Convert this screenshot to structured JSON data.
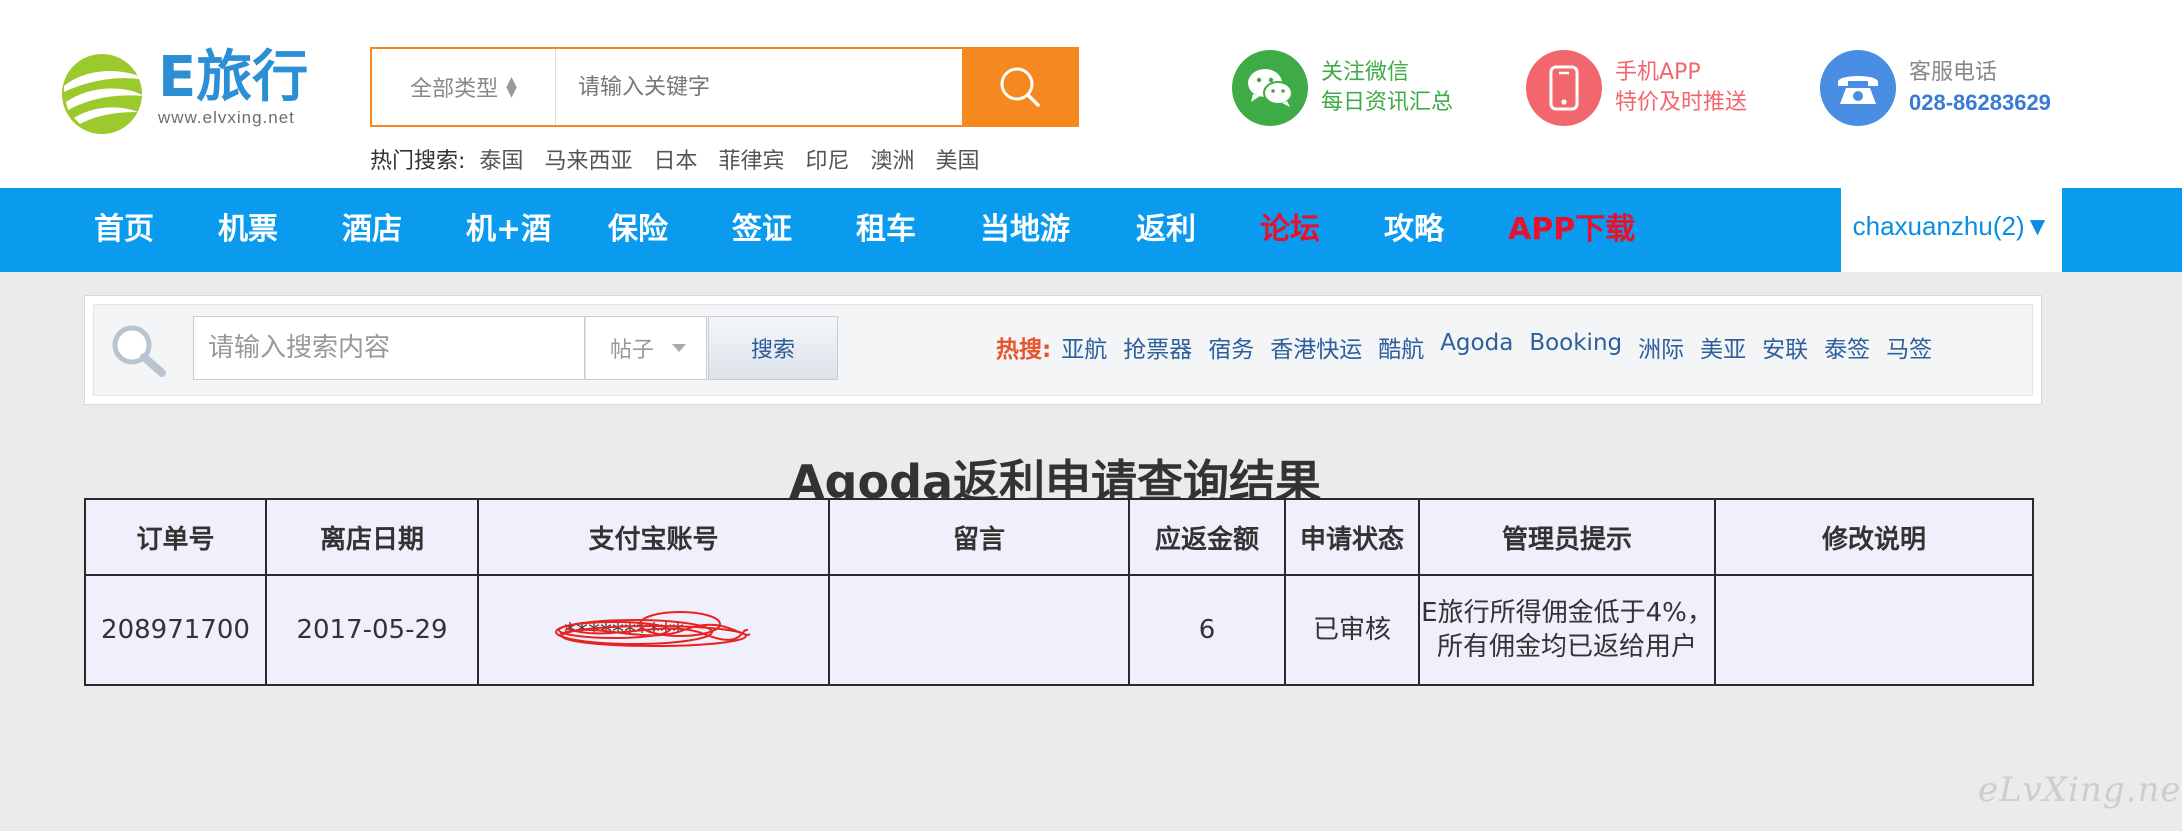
{
  "header": {
    "logo_brand": "E旅行",
    "logo_domain": "www.elvxing.net",
    "search": {
      "type_value": "全部类型",
      "placeholder": "请输入关键字"
    },
    "hot_label": "热门搜索:",
    "hot_items": [
      "泰国",
      "马来西亚",
      "日本",
      "菲律宾",
      "印尼",
      "澳洲",
      "美国"
    ],
    "promos": {
      "wechat": {
        "line1": "关注微信",
        "line2": "每日资讯汇总",
        "icon": "wechat-icon"
      },
      "app": {
        "line1": "手机APP",
        "line2": "特价及时推送",
        "icon": "phone-app-icon"
      },
      "phone": {
        "line1": "客服电话",
        "line2": "028-86283629",
        "icon": "telephone-icon"
      }
    }
  },
  "nav": {
    "items": [
      "首页",
      "机票",
      "酒店",
      "机+酒",
      "保险",
      "签证",
      "租车",
      "当地游",
      "返利",
      "论坛",
      "攻略",
      "APP下载"
    ],
    "highlight_color": "#e8112d",
    "bar_color": "#0a9bee",
    "user": "chaxuanzhu(2)▼"
  },
  "forum_search": {
    "placeholder": "请输入搜索内容",
    "type_value": "帖子",
    "button": "搜索",
    "hot_label": "热搜:",
    "hot_items": [
      "亚航",
      "抢票器",
      "宿务",
      "香港快运",
      "酷航",
      "Agoda",
      "Booking",
      "洲际",
      "美亚",
      "安联",
      "泰签",
      "马签"
    ]
  },
  "result": {
    "title": "Agoda返利申请查询结果",
    "headers": [
      "订单号",
      "离店日期",
      "支付宝账号",
      "留言",
      "应返金额",
      "申请状态",
      "管理员提示",
      "修改说明"
    ],
    "row": {
      "order_no": "208971700",
      "checkout_date": "2017-05-29",
      "alipay_account": "",
      "message": "",
      "amount": "6",
      "status": "已审核",
      "admin_note": "E旅行所得佣金低于4%，所有佣金均已返给用户",
      "edit_note": ""
    }
  },
  "watermark": "eLvXing.net"
}
